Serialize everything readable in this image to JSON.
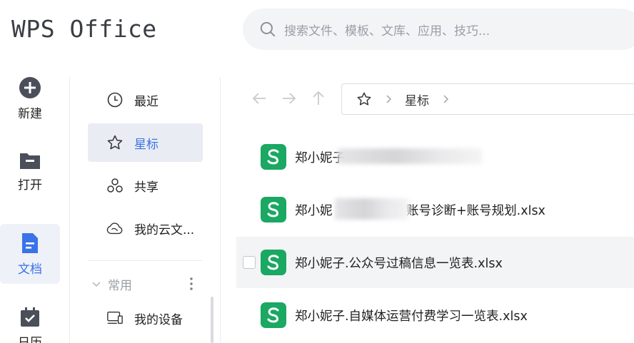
{
  "header": {
    "logo_text": "WPS Office",
    "search_placeholder": "搜索文件、模板、文库、应用、技巧..."
  },
  "rail": {
    "items": [
      {
        "label": "新建",
        "icon": "plus-circle-icon"
      },
      {
        "label": "打开",
        "icon": "folder-icon"
      },
      {
        "label": "文档",
        "icon": "document-icon",
        "active": true
      },
      {
        "label": "日历",
        "icon": "calendar-icon"
      }
    ]
  },
  "nav": {
    "items": [
      {
        "label": "最近",
        "icon": "clock-icon"
      },
      {
        "label": "星标",
        "icon": "star-icon",
        "active": true
      },
      {
        "label": "共享",
        "icon": "share-icon"
      },
      {
        "label": "我的云文...",
        "icon": "cloud-icon"
      }
    ],
    "section_label": "常用",
    "section_items": [
      {
        "label": "我的设备",
        "icon": "device-icon"
      }
    ]
  },
  "breadcrumb": {
    "crumb": "星标"
  },
  "files": [
    {
      "name": "郑小妮子",
      "blurred": true
    },
    {
      "name_left": "郑小妮",
      "name_right": "账号诊断+账号规划.xlsx",
      "blurred": true
    },
    {
      "name": "郑小妮子.公众号过稿信息一览表.xlsx",
      "hover": true
    },
    {
      "name": "郑小妮子.自媒体运营付费学习一览表.xlsx"
    }
  ],
  "colors": {
    "accent": "#3a73e8",
    "sheet_green": "#1aa862"
  }
}
